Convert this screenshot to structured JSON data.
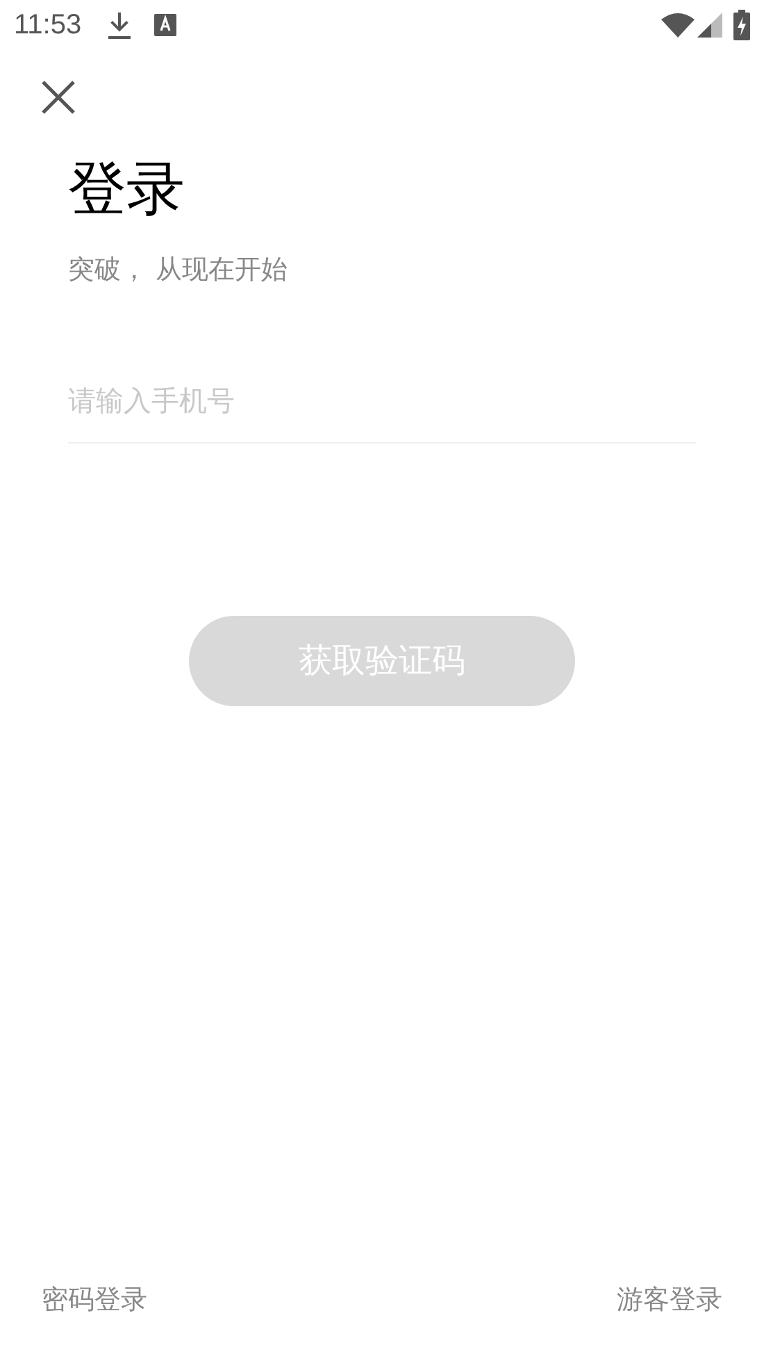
{
  "status_bar": {
    "time": "11:53"
  },
  "title": "登录",
  "subtitle": "突破， 从现在开始",
  "phone_field": {
    "placeholder": "请输入手机号"
  },
  "get_code_button": {
    "label": "获取验证码",
    "disabled": true
  },
  "footer": {
    "left_link": "密码登录",
    "right_link": "游客登录"
  }
}
